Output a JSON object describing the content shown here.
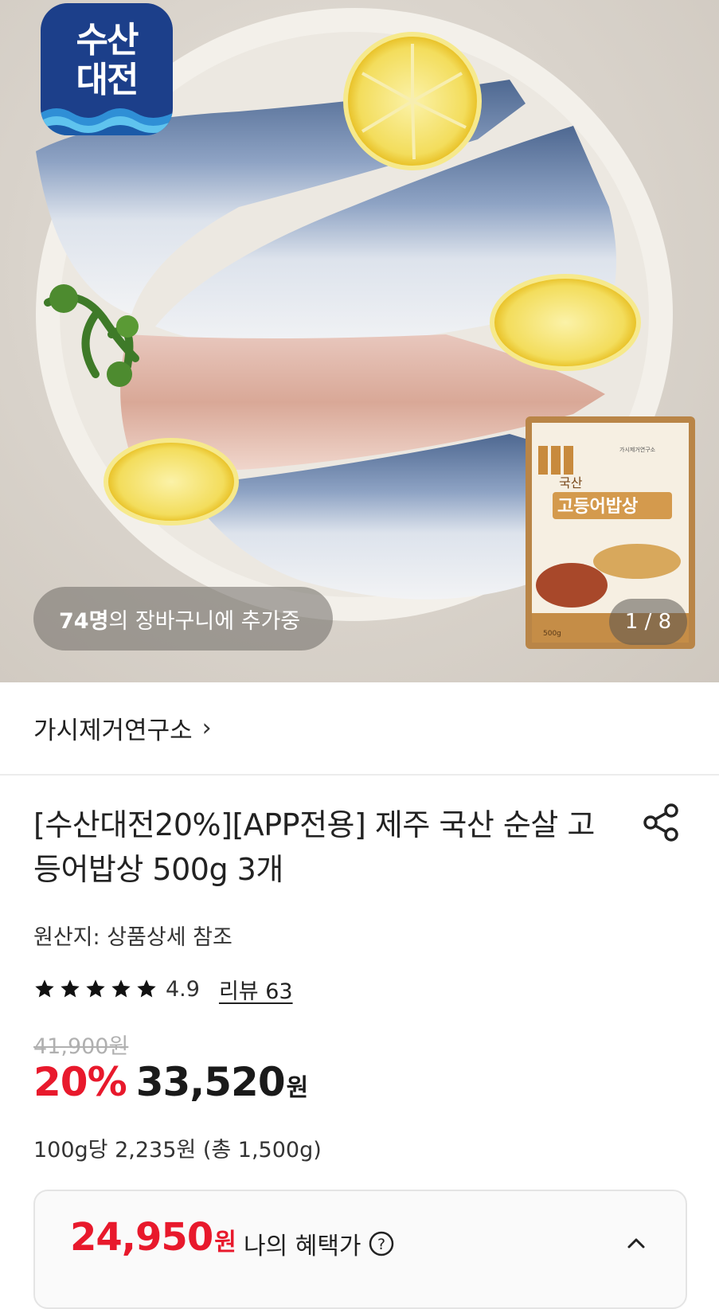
{
  "hero": {
    "logo_line1": "수산",
    "logo_line2": "대전",
    "cart_count": "74명",
    "cart_text": "의 장바구니에 추가중",
    "counter": "1 / 8",
    "package_text": "국산 고등어밥상",
    "package_brand": "가시제거연구소",
    "package_weight": "500g"
  },
  "brand": {
    "name": "가시제거연구소",
    "chevron": "›"
  },
  "product": {
    "title": "[수산대전20%][APP전용] 제주 국산 순살 고등어밥상 500g 3개",
    "origin": "원산지: 상품상세 참조",
    "rating": "4.9",
    "stars": 5,
    "review": "리뷰 63",
    "original_price": "41,900원",
    "discount": "20%",
    "sale_price": "33,520",
    "won": "원",
    "unit_price": "100g당 2,235원 (총 1,500g)"
  },
  "benefit": {
    "price": "24,950",
    "won": "원",
    "label": "나의 혜택가"
  },
  "colors": {
    "accent_red": "#e8192c",
    "logo_blue": "#1c3f8a"
  }
}
